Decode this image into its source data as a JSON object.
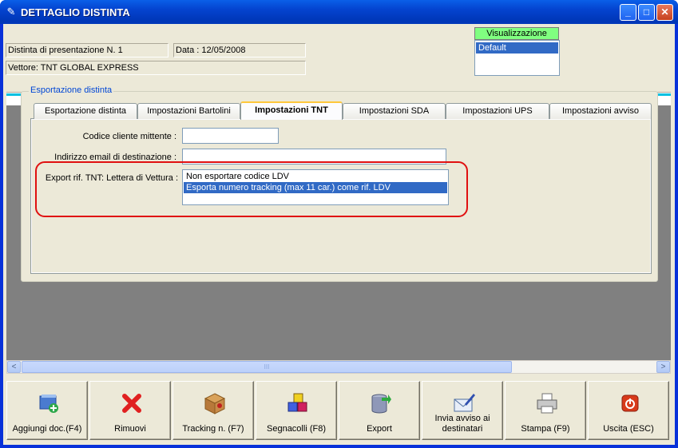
{
  "window": {
    "title": "DETTAGLIO DISTINTA",
    "minimize": "_",
    "maximize": "□",
    "close": "✕"
  },
  "header": {
    "distinta": "Distinta di presentazione N. 1",
    "data": "Data : 12/05/2008",
    "vettore": "Vettore: TNT GLOBAL EXPRESS"
  },
  "visualizzazione": {
    "title": "Visualizzazione",
    "selected": "Default"
  },
  "export_group": {
    "label": "Esportazione distinta",
    "tabs": [
      {
        "label": "Esportazione distinta"
      },
      {
        "label": "Impostazioni Bartolini"
      },
      {
        "label": "Impostazioni TNT"
      },
      {
        "label": "Impostazioni SDA"
      },
      {
        "label": "Impostazioni UPS"
      },
      {
        "label": "Impostazioni avviso"
      }
    ],
    "active_tab": "Impostazioni TNT",
    "fields": {
      "codice_label": "Codice cliente mittente :",
      "codice_value": "",
      "email_label": "Indirizzo email di destinazione :",
      "email_value": "",
      "export_label": "Export rif. TNT: Lettera di Vettura :",
      "export_options": [
        "Non esportare codice LDV",
        "Esporta numero tracking (max 11 car.) come rif. LDV"
      ],
      "export_selected": "Esporta numero tracking (max 11 car.) come rif. LDV"
    }
  },
  "scrollbar": {
    "left": "<",
    "right": ">",
    "grip": "III"
  },
  "toolbar": {
    "buttons": [
      {
        "label": "Aggiungi doc.(F4)",
        "icon": "add-document-icon"
      },
      {
        "label": "Rimuovi",
        "icon": "red-x-icon"
      },
      {
        "label": "Tracking n. (F7)",
        "icon": "package-icon"
      },
      {
        "label": "Segnacolli (F8)",
        "icon": "cubes-icon"
      },
      {
        "label": "Export",
        "icon": "database-export-icon"
      },
      {
        "label": "Invia avviso ai destinatari",
        "icon": "envelope-pen-icon"
      },
      {
        "label": "Stampa (F9)",
        "icon": "printer-icon"
      },
      {
        "label": "Uscita (ESC)",
        "icon": "power-icon"
      }
    ]
  },
  "colors": {
    "titlebar": "#0443cf",
    "selection": "#316ac5",
    "highlight_border": "#e01010",
    "vis_header": "#80ff80"
  }
}
